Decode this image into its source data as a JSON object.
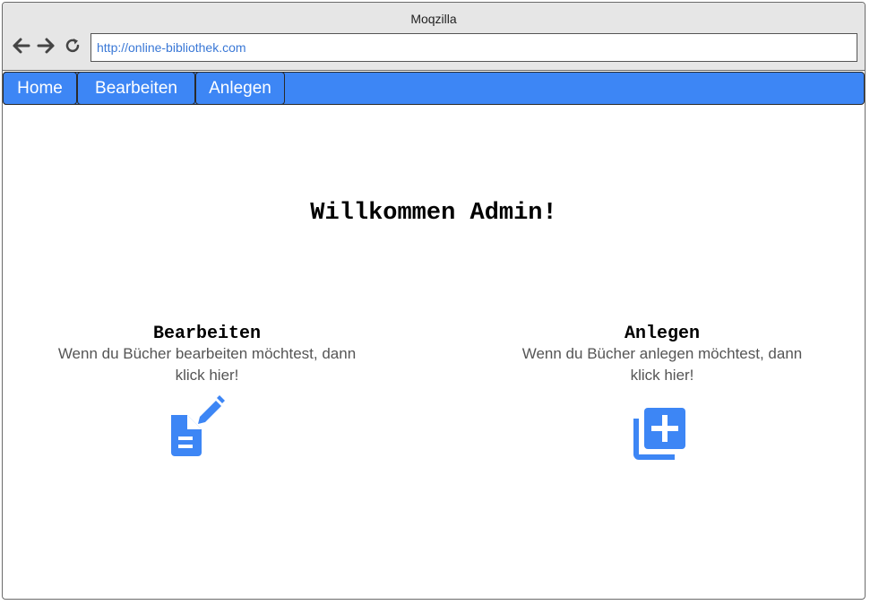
{
  "browser": {
    "title": "Moqzilla",
    "url": "http://online-bibliothek.com"
  },
  "nav": {
    "items": [
      {
        "label": "Home"
      },
      {
        "label": "Bearbeiten"
      },
      {
        "label": "Anlegen"
      }
    ]
  },
  "main": {
    "welcome": "Willkommen Admin!",
    "cards": [
      {
        "title": "Bearbeiten",
        "description": "Wenn du Bücher bearbeiten möchtest, dann klick hier!",
        "icon": "edit-document-icon"
      },
      {
        "title": "Anlegen",
        "description": "Wenn du Bücher anlegen möchtest, dann klick hier!",
        "icon": "add-library-icon"
      }
    ]
  },
  "colors": {
    "accent": "#3d86f5",
    "url_text": "#3a78d6",
    "description_text": "#555555"
  }
}
